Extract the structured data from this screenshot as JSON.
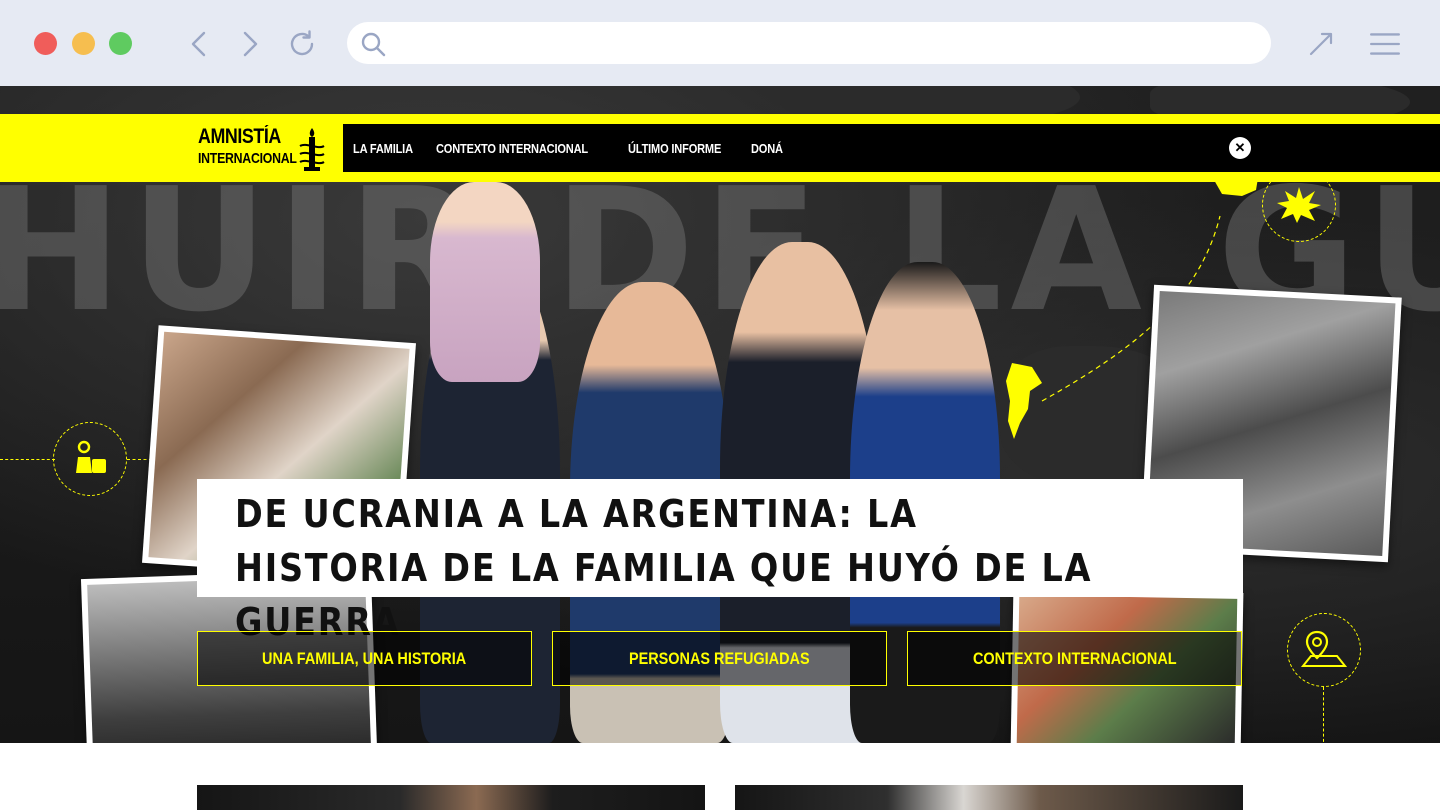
{
  "browser": {
    "url_value": "",
    "icons": [
      "back-icon",
      "forward-icon",
      "reload-icon",
      "search-icon",
      "expand-icon",
      "menu-icon"
    ]
  },
  "brand": {
    "line1": "AMNISTÍA",
    "line2": "INTERNACIONAL",
    "colors": {
      "yellow": "#ffff00",
      "black": "#000000"
    }
  },
  "nav": {
    "items": [
      {
        "label": "LA FAMILIA"
      },
      {
        "label": "CONTEXTO INTERNACIONAL"
      },
      {
        "label": "ÚLTIMO INFORME"
      },
      {
        "label": "DONÁ"
      }
    ],
    "close_label": "✕"
  },
  "hero": {
    "background_text": "HUIR DE LA GUERRA",
    "headline": "De Ucrania a la Argentina: la historia de la familia que huyó de la guerra",
    "buttons": [
      {
        "label": "UNA FAMILIA, UNA HISTORIA"
      },
      {
        "label": "PERSONAS REFUGIADAS"
      },
      {
        "label": "CONTEXTO INTERNACIONAL"
      }
    ]
  }
}
